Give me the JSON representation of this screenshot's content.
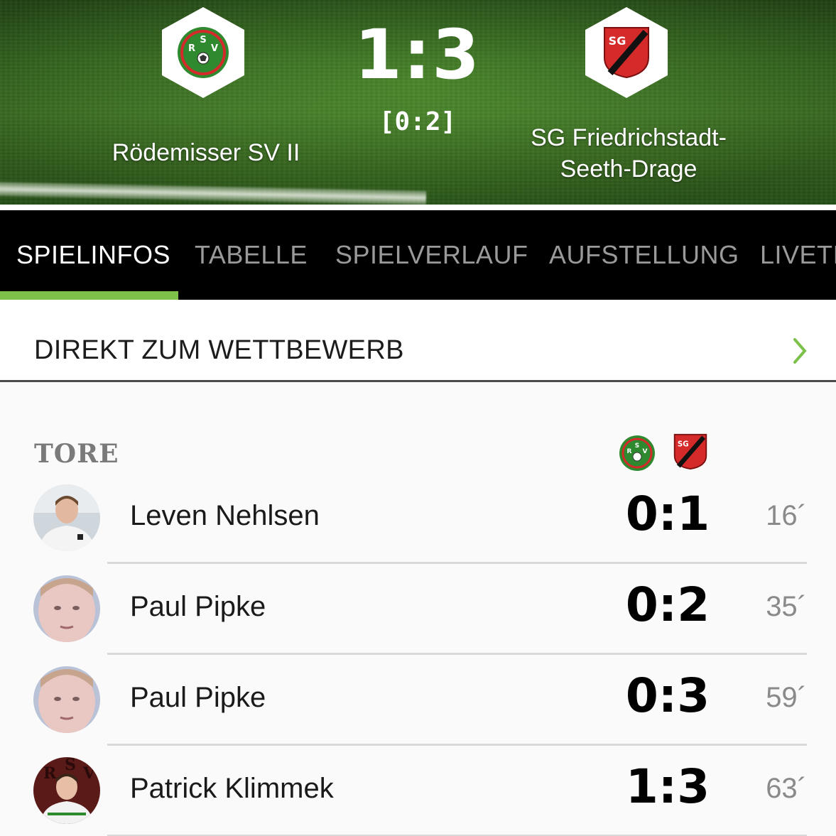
{
  "match": {
    "score": "1:3",
    "halftime": "[0:2]",
    "home_team": "Rödemisser SV II",
    "away_team_line1": "SG Friedrichstadt-",
    "away_team_line2": "Seeth-Drage",
    "home_logo_text": "RSV",
    "away_logo_text": "SG"
  },
  "tabs": [
    {
      "label": "SPIELINFOS",
      "active": true
    },
    {
      "label": "TABELLE"
    },
    {
      "label": "SPIELVERLAUF"
    },
    {
      "label": "AUFSTELLUNG"
    },
    {
      "label": "LIVETI"
    }
  ],
  "direct_link": {
    "label": "DIREKT ZUM WETTBEWERB"
  },
  "goals": {
    "heading": "TORE",
    "items": [
      {
        "player": "Leven Nehlsen",
        "score": "0:1",
        "minute": "16´"
      },
      {
        "player": "Paul Pipke",
        "score": "0:2",
        "minute": "35´"
      },
      {
        "player": "Paul Pipke",
        "score": "0:3",
        "minute": "59´"
      },
      {
        "player": "Patrick Klimmek",
        "score": "1:3",
        "minute": "63´"
      }
    ]
  },
  "colors": {
    "accent_green": "#7dc14a",
    "tabbar_bg": "#000000",
    "home_green": "#2f8a2f",
    "away_red": "#d42a2a"
  }
}
